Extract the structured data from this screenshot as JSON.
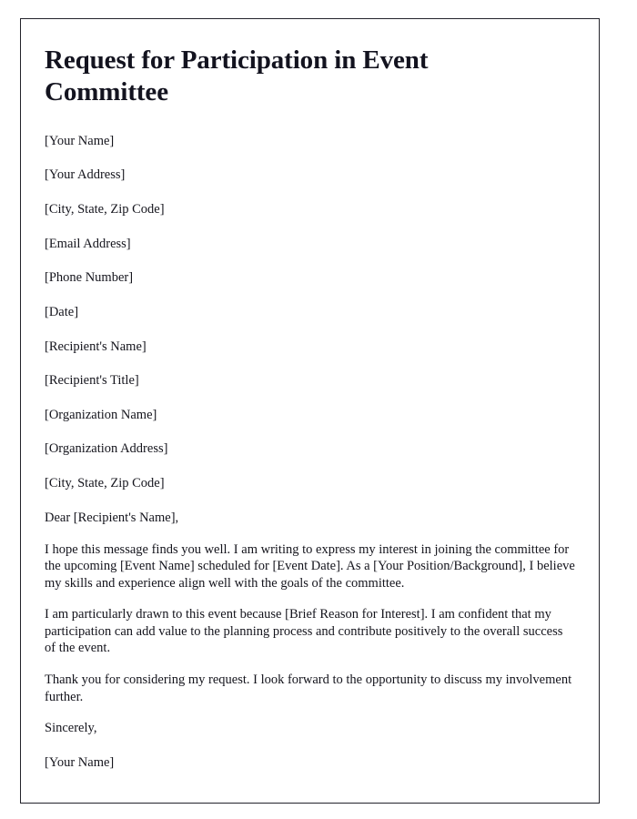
{
  "document": {
    "title": "Request for Participation in Event Committee",
    "sender_block": [
      "[Your Name]",
      "[Your Address]",
      "[City, State, Zip Code]",
      "[Email Address]",
      "[Phone Number]",
      "[Date]"
    ],
    "recipient_block": [
      "[Recipient's Name]",
      "[Recipient's Title]",
      "[Organization Name]",
      "[Organization Address]",
      "[City, State, Zip Code]"
    ],
    "salutation": "Dear [Recipient's Name],",
    "paragraphs": [
      "I hope this message finds you well. I am writing to express my interest in joining the committee for the upcoming [Event Name] scheduled for [Event Date]. As a [Your Position/Background], I believe my skills and experience align well with the goals of the committee.",
      "I am particularly drawn to this event because [Brief Reason for Interest]. I am confident that my participation can add value to the planning process and contribute positively to the overall success of the event.",
      "Thank you for considering my request. I look forward to the opportunity to discuss my involvement further."
    ],
    "closing": "Sincerely,",
    "signature_name": "[Your Name]",
    "colors": {
      "page_border": "#23232b",
      "title_text": "#13131f",
      "body_text": "#14141c",
      "page_background": "#ffffff"
    }
  }
}
